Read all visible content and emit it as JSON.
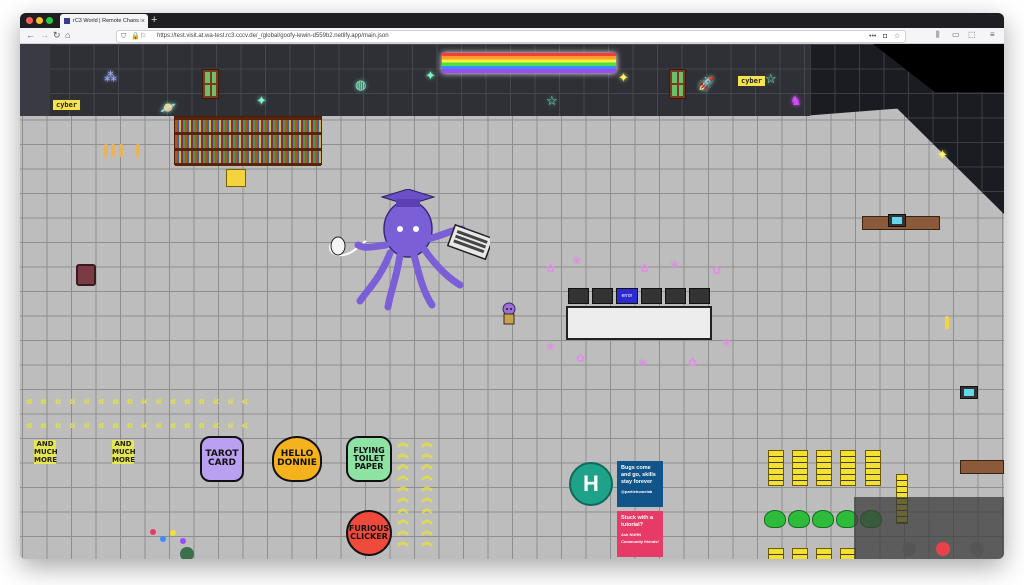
{
  "browser": {
    "tab_title": "rC3 World | Remote Chaos Exp...",
    "new_tab_symbol": "+",
    "url": "https://test.visit.at.wa-test.rc3.cccv.de/_/global/goofy-lewin-d559b2.netlify.app/main.json",
    "url_more": "•••"
  },
  "game": {
    "wall_signs": [
      "cyber",
      "cyber"
    ],
    "stickers": {
      "tarot": "TAROT CARD",
      "hello": "HELLO DONNIE",
      "toilet": "FLYING TOILET PAPER",
      "clicker": "FURIOUS CLICKER"
    },
    "side_text": [
      "AND MUCH MORE",
      "AND MUCH MORE"
    ],
    "desk_screens": [
      "",
      "",
      "error",
      "",
      "",
      ""
    ],
    "hr_badge_letter": "H",
    "cards": {
      "bugs": "Bugs come and go, skills stay forever",
      "bugs_handle": "@partiehomelab",
      "tutorial": "Stuck with a tutorial?",
      "tutorial_sub": "Ask NUHN Community friends!"
    },
    "arrows_left": "«",
    "arrows_up": "»",
    "colors": {
      "floor": "#bdbdbd",
      "wall": "#2f3036",
      "squid": "#7b5fd6",
      "sign": "#f6e34b",
      "neon": "#7cf2c7"
    }
  }
}
